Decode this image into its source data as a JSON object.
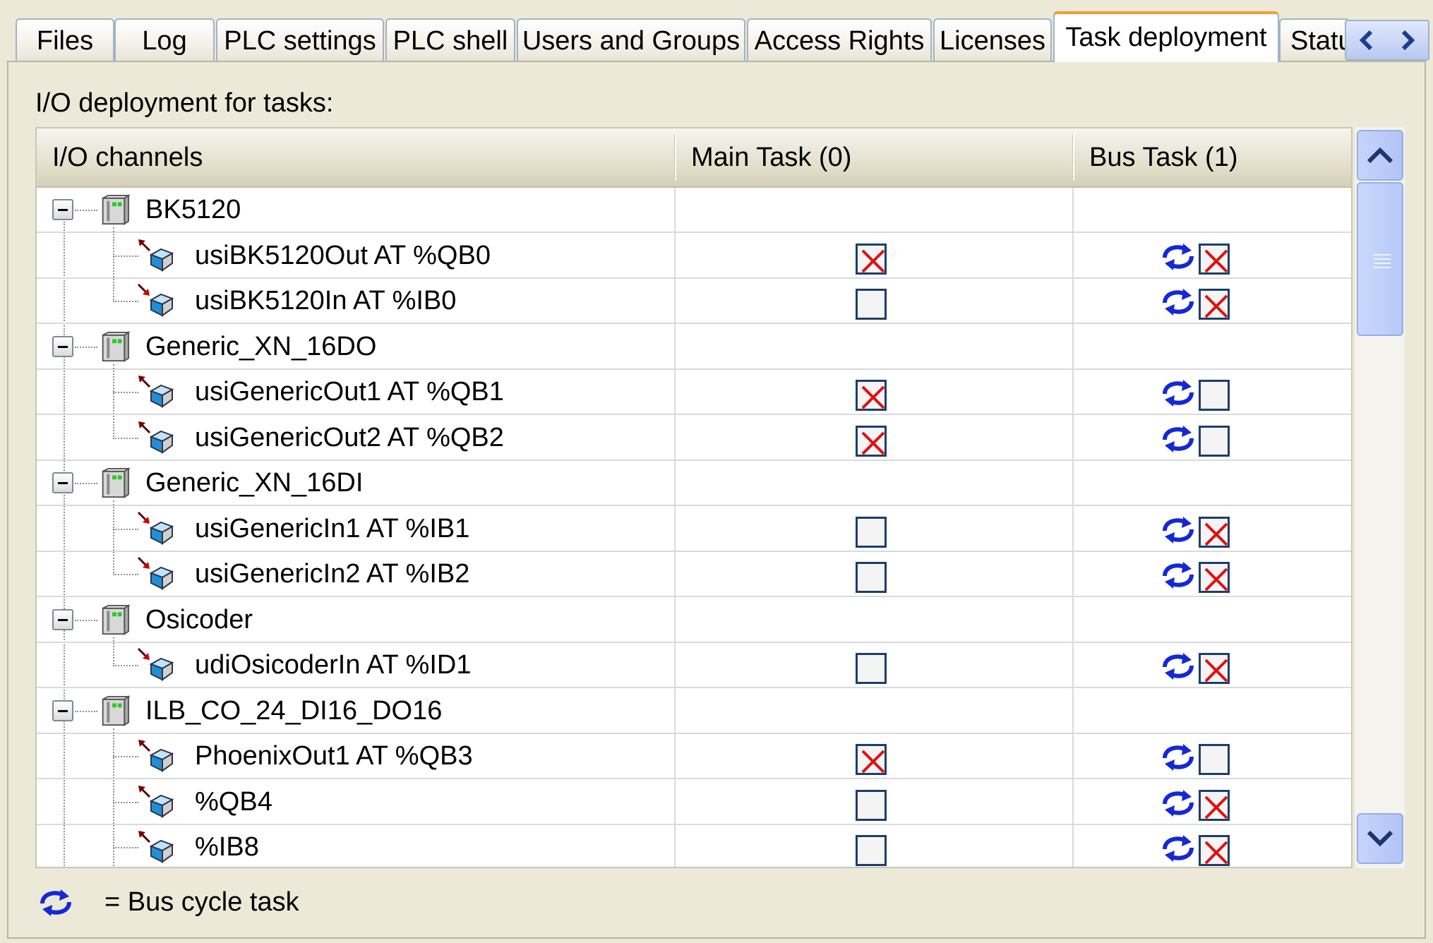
{
  "tabs": [
    {
      "label": "Files",
      "active": false
    },
    {
      "label": "Log",
      "active": false
    },
    {
      "label": "PLC settings",
      "active": false
    },
    {
      "label": "PLC shell",
      "active": false
    },
    {
      "label": "Users and Groups",
      "active": false
    },
    {
      "label": "Access Rights",
      "active": false
    },
    {
      "label": "Licenses",
      "active": false
    },
    {
      "label": "Task deployment",
      "active": true
    },
    {
      "label": "Statu",
      "active": false
    }
  ],
  "section_label": "I/O deployment for tasks:",
  "columns": {
    "channels": "I/O channels",
    "main_task": "Main Task (0)",
    "bus_task": "Bus Task (1)"
  },
  "rows": [
    {
      "kind": "device",
      "name": "BK5120"
    },
    {
      "kind": "channel",
      "dir": "out",
      "name": "usiBK5120Out AT %QB0",
      "main": true,
      "bus": true
    },
    {
      "kind": "channel",
      "dir": "in",
      "name": "usiBK5120In AT %IB0",
      "main": false,
      "bus": true
    },
    {
      "kind": "device",
      "name": "Generic_XN_16DO"
    },
    {
      "kind": "channel",
      "dir": "out",
      "name": "usiGenericOut1 AT %QB1",
      "main": true,
      "bus": false
    },
    {
      "kind": "channel",
      "dir": "out",
      "name": "usiGenericOut2 AT %QB2",
      "main": true,
      "bus": false
    },
    {
      "kind": "device",
      "name": "Generic_XN_16DI"
    },
    {
      "kind": "channel",
      "dir": "in",
      "name": "usiGenericIn1 AT %IB1",
      "main": false,
      "bus": true
    },
    {
      "kind": "channel",
      "dir": "in",
      "name": "usiGenericIn2 AT %IB2",
      "main": false,
      "bus": true
    },
    {
      "kind": "device",
      "name": "Osicoder"
    },
    {
      "kind": "channel",
      "dir": "in",
      "name": "udiOsicoderIn AT %ID1",
      "main": false,
      "bus": true
    },
    {
      "kind": "device",
      "name": "ILB_CO_24_DI16_DO16"
    },
    {
      "kind": "channel",
      "dir": "out",
      "name": "PhoenixOut1 AT %QB3",
      "main": true,
      "bus": false
    },
    {
      "kind": "channel",
      "dir": "out",
      "name": "%QB4",
      "main": false,
      "bus": true
    },
    {
      "kind": "channel",
      "dir": "out",
      "name": "%IB8",
      "main": false,
      "bus": true
    }
  ],
  "legend": {
    "icon": "bus-cycle-icon",
    "text": "= Bus cycle task"
  },
  "icons": {
    "device": "device-module-icon",
    "out_channel": "output-channel-icon",
    "in_channel": "input-channel-icon",
    "bus": "bus-cycle-icon",
    "scroll_up": "chevron-up-icon",
    "scroll_down": "chevron-down-icon",
    "tab_left": "chevron-left-icon",
    "tab_right": "chevron-right-icon"
  },
  "colors": {
    "active_tab_accent": "#f0a030",
    "check_mark": "#e01010",
    "bus_icon": "#1428d8",
    "checkbox_border": "#1c3f6a"
  }
}
